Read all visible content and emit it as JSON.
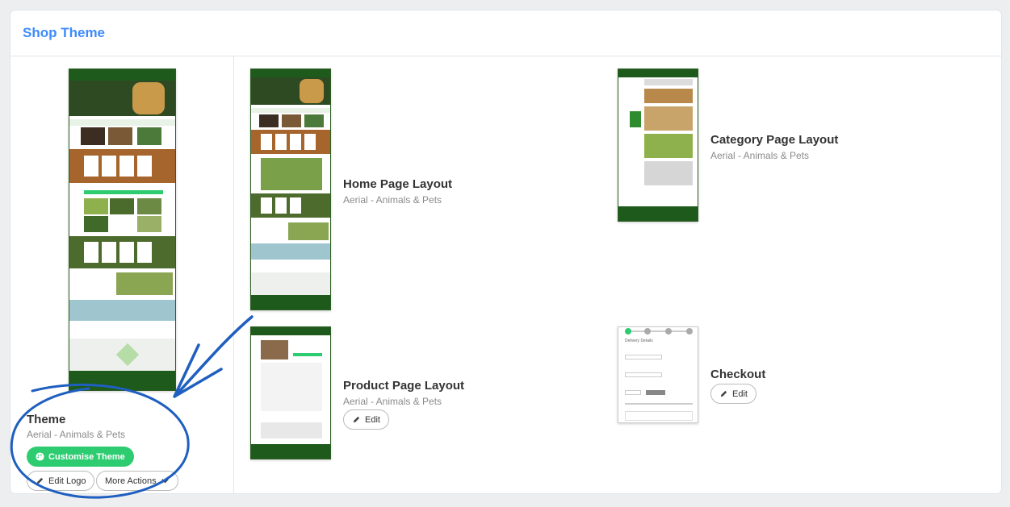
{
  "card": {
    "title": "Shop Theme"
  },
  "theme": {
    "title": "Theme",
    "subtitle": "Aerial - Animals & Pets",
    "customise_label": "Customise Theme",
    "edit_logo_label": "Edit Logo",
    "more_actions_label": "More Actions"
  },
  "layouts": [
    {
      "title": "Home Page Layout",
      "subtitle": "Aerial - Animals & Pets"
    },
    {
      "title": "Category Page Layout",
      "subtitle": "Aerial - Animals & Pets"
    },
    {
      "title": "Product Page Layout",
      "subtitle": "Aerial - Animals & Pets",
      "edit_label": "Edit"
    },
    {
      "title": "Checkout",
      "edit_label": "Edit",
      "preview_heading": "Delivery Details"
    }
  ],
  "colors": {
    "accent": "#3d8bfd",
    "brand_green": "#1e5a1c",
    "action_green": "#2ecc71",
    "annotation_blue": "#1f5fbf"
  }
}
